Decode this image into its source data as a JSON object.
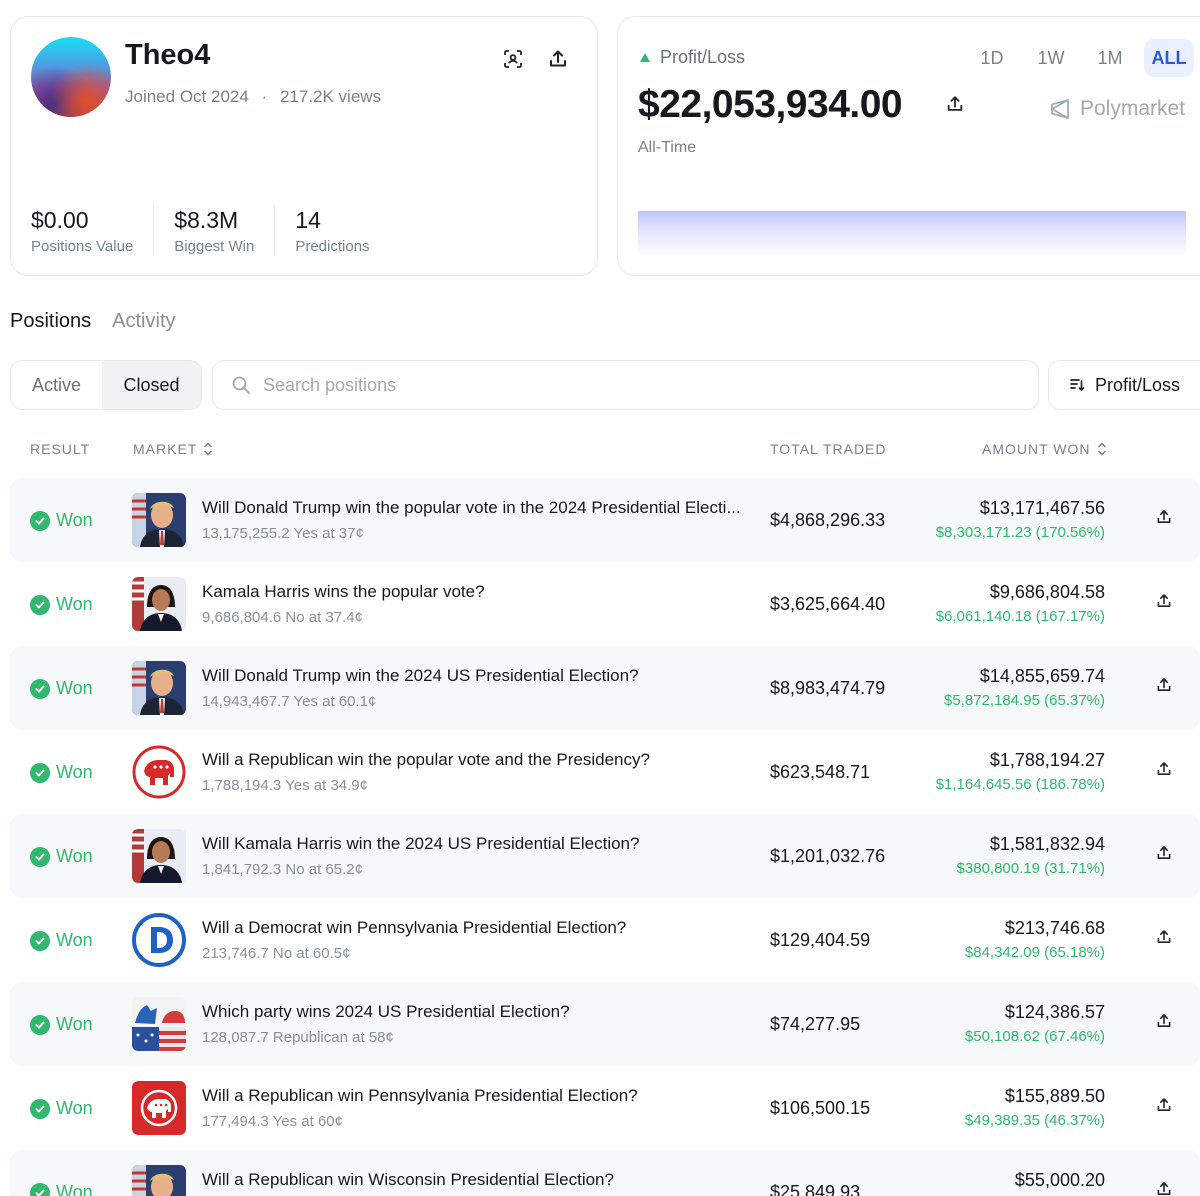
{
  "profile": {
    "username": "Theo4",
    "joined": "Joined Oct 2024",
    "separator": "·",
    "views": "217.2K views",
    "stats": [
      {
        "value": "$0.00",
        "label": "Positions Value"
      },
      {
        "value": "$8.3M",
        "label": "Biggest Win"
      },
      {
        "value": "14",
        "label": "Predictions"
      }
    ]
  },
  "pl": {
    "label": "Profit/Loss",
    "amount": "$22,053,934.00",
    "period": "All-Time",
    "brand": "Polymarket",
    "timeframes": [
      "1D",
      "1W",
      "1M",
      "ALL"
    ],
    "active_timeframe": "ALL"
  },
  "tabs": [
    "Positions",
    "Activity"
  ],
  "filters": {
    "segments": [
      "Active",
      "Closed"
    ],
    "active_segment": "Closed",
    "search_placeholder": "Search positions",
    "sort_label": "Profit/Loss"
  },
  "table": {
    "headers": {
      "result": "RESULT",
      "market": "MARKET",
      "total_traded": "TOTAL TRADED",
      "amount_won": "AMOUNT WON"
    },
    "rows": [
      {
        "result": "Won",
        "thumb": "trump",
        "title": "Will Donald Trump win the popular vote in the 2024 Presidential Electi...",
        "sub": "13,175,255.2 Yes at 37¢",
        "traded": "$4,868,296.33",
        "won": "$13,171,467.56",
        "gain": "$8,303,171.23 (170.56%)"
      },
      {
        "result": "Won",
        "thumb": "harris",
        "title": "Kamala Harris wins the popular vote?",
        "sub": "9,686,804.6 No at 37.4¢",
        "traded": "$3,625,664.40",
        "won": "$9,686,804.58",
        "gain": "$6,061,140.18 (167.17%)"
      },
      {
        "result": "Won",
        "thumb": "trump",
        "title": "Will Donald Trump win the 2024 US Presidential Election?",
        "sub": "14,943,467.7 Yes at 60.1¢",
        "traded": "$8,983,474.79",
        "won": "$14,855,659.74",
        "gain": "$5,872,184.95 (65.37%)"
      },
      {
        "result": "Won",
        "thumb": "gop-circle",
        "title": "Will a Republican win the popular vote and the Presidency?",
        "sub": "1,788,194.3 Yes at 34.9¢",
        "traded": "$623,548.71",
        "won": "$1,788,194.27",
        "gain": "$1,164,645.56 (186.78%)"
      },
      {
        "result": "Won",
        "thumb": "harris",
        "title": "Will Kamala Harris win the 2024 US Presidential Election?",
        "sub": "1,841,792.3 No at 65.2¢",
        "traded": "$1,201,032.76",
        "won": "$1,581,832.94",
        "gain": "$380,800.19 (31.71%)"
      },
      {
        "result": "Won",
        "thumb": "dem",
        "title": "Will a Democrat win Pennsylvania Presidential Election?",
        "sub": "213,746.7 No at 60.5¢",
        "traded": "$129,404.59",
        "won": "$213,746.68",
        "gain": "$84,342.09 (65.18%)"
      },
      {
        "result": "Won",
        "thumb": "parties",
        "title": "Which party wins 2024 US Presidential Election?",
        "sub": "128,087.7 Republican at 58¢",
        "traded": "$74,277.95",
        "won": "$124,386.57",
        "gain": "$50,108.62 (67.46%)"
      },
      {
        "result": "Won",
        "thumb": "gop-square",
        "title": "Will a Republican win Pennsylvania Presidential Election?",
        "sub": "177,494.3 Yes at 60¢",
        "traded": "$106,500.15",
        "won": "$155,889.50",
        "gain": "$49,389.35 (46.37%)"
      },
      {
        "result": "Won",
        "thumb": "trump",
        "title": "Will a Republican win Wisconsin Presidential Election?",
        "sub": "",
        "traded": "$25,849.93",
        "won": "$55,000.20",
        "gain": ""
      }
    ]
  },
  "colors": {
    "accent": "#2a5bd7",
    "positive": "#2fb86e",
    "chart_fill": "#c5c8fb"
  },
  "icons": {
    "profile_qr": "scan-icon",
    "share": "share-icon",
    "search": "search-icon",
    "sort": "sort-icon",
    "check": "check-circle-icon"
  }
}
